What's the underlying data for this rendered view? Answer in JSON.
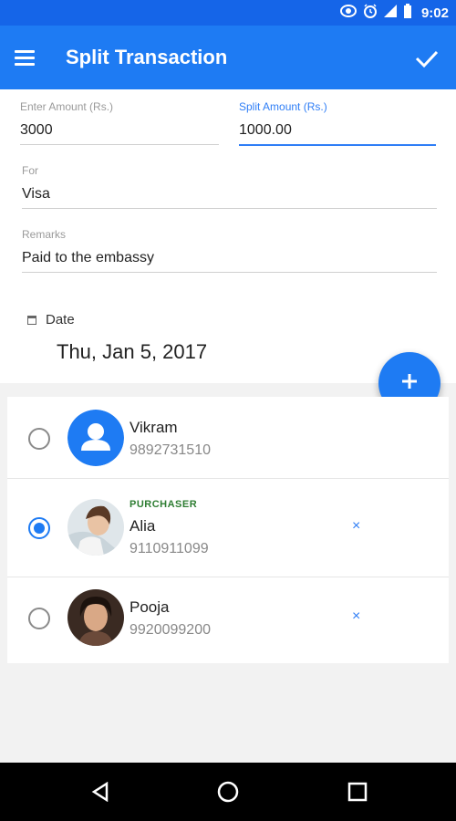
{
  "status_bar": {
    "time": "9:02",
    "icons": [
      "data-saver-icon",
      "alarm-icon",
      "signal-icon",
      "battery-icon"
    ]
  },
  "app_bar": {
    "title": "Split Transaction",
    "menu_icon": "menu-icon",
    "confirm_icon": "check-icon"
  },
  "form": {
    "enter_amount": {
      "label": "Enter Amount (Rs.)",
      "value": "3000"
    },
    "split_amount": {
      "label": "Split Amount (Rs.)",
      "value": "1000.00"
    },
    "for": {
      "label": "For",
      "value": "Visa"
    },
    "remarks": {
      "label": "Remarks",
      "value": "Paid to the embassy"
    },
    "date": {
      "label": "Date",
      "value": "Thu, Jan 5, 2017"
    }
  },
  "fab": {
    "icon": "plus-icon"
  },
  "people": [
    {
      "name": "Vikram",
      "phone": "9892731510",
      "badge": "",
      "selected": false,
      "removable": false
    },
    {
      "name": "Alia",
      "phone": "9110911099",
      "badge": "PURCHASER",
      "selected": true,
      "removable": true
    },
    {
      "name": "Pooja",
      "phone": "9920099200",
      "badge": "",
      "selected": false,
      "removable": true
    }
  ],
  "remove_symbol": "×",
  "colors": {
    "primary": "#1e7bf3",
    "status_bar": "#1565e8",
    "purchaser_badge": "#2e7d32"
  },
  "nav_bar": {
    "buttons": [
      "back-icon",
      "home-icon",
      "recents-icon"
    ]
  }
}
